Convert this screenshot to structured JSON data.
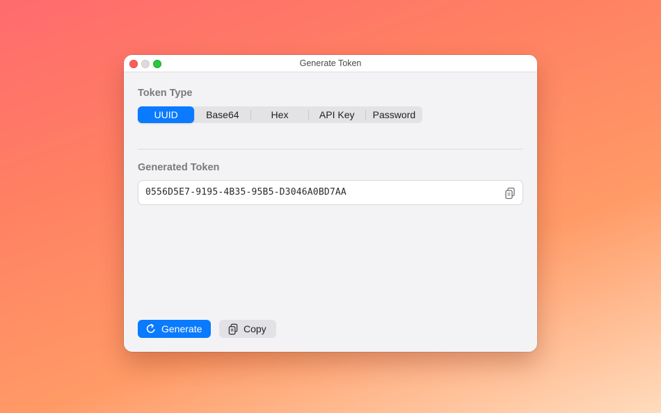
{
  "window": {
    "title": "Generate Token"
  },
  "token_type": {
    "label": "Token Type",
    "options": [
      "UUID",
      "Base64",
      "Hex",
      "API Key",
      "Password"
    ],
    "selected": "UUID"
  },
  "generated": {
    "label": "Generated Token",
    "value": "0556D5E7-9195-4B35-95B5-D3046A0BD7AA"
  },
  "buttons": {
    "generate_label": "Generate",
    "copy_label": "Copy"
  },
  "icons": {
    "copy": "copy-icon",
    "refresh": "refresh-icon"
  },
  "colors": {
    "accent": "#0a7aff",
    "close": "#ff5f57",
    "maximize": "#28c840"
  }
}
